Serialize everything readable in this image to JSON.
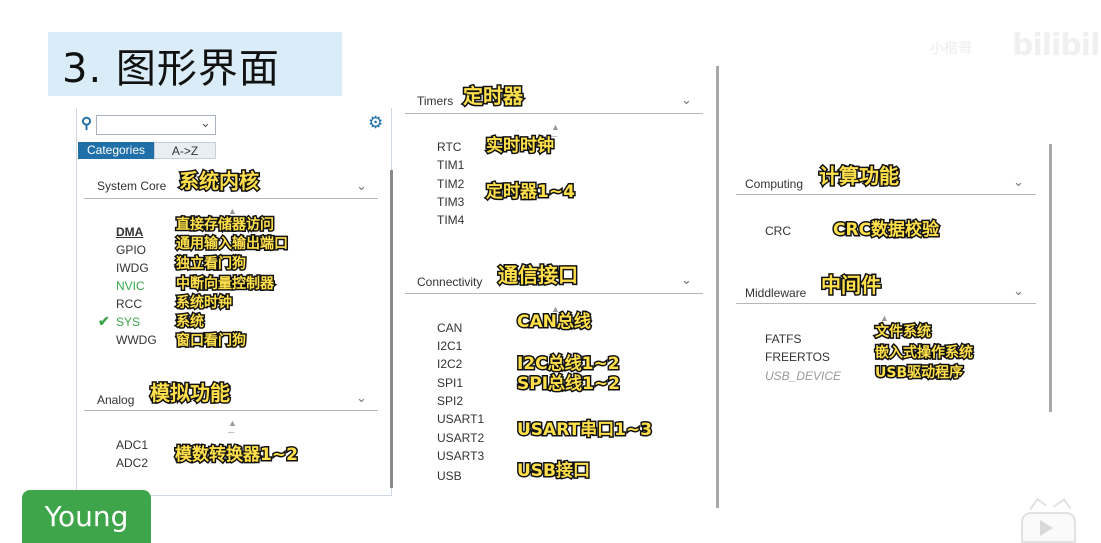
{
  "slide": {
    "title": "3. 图形界面",
    "watermark": "bilibili",
    "watermark_small": "小楷哥",
    "author_badge": "Young"
  },
  "left_panel": {
    "tabs": [
      "Categories",
      "A->Z"
    ],
    "sections": {
      "system_core": {
        "label": "System Core",
        "annotation": "系统内核",
        "items": [
          {
            "name": "DMA",
            "note": "直接存储器访问"
          },
          {
            "name": "GPIO",
            "note": "通用输入输出端口"
          },
          {
            "name": "IWDG",
            "note": "独立看门狗"
          },
          {
            "name": "NVIC",
            "note": "中断向量控制器"
          },
          {
            "name": "RCC",
            "note": "系统时钟"
          },
          {
            "name": "SYS",
            "note": "系统"
          },
          {
            "name": "WWDG",
            "note": "窗口看门狗"
          }
        ]
      },
      "analog": {
        "label": "Analog",
        "annotation": "模拟功能",
        "items": [
          "ADC1",
          "ADC2"
        ],
        "note": "模数转换器1~2"
      }
    }
  },
  "middle_panel": {
    "timers": {
      "label": "Timers",
      "annotation": "定时器",
      "items": [
        "RTC",
        "TIM1",
        "TIM2",
        "TIM3",
        "TIM4"
      ],
      "notes": {
        "rtc": "实时时钟",
        "tim": "定时器1~4"
      }
    },
    "connectivity": {
      "label": "Connectivity",
      "annotation": "通信接口",
      "items": [
        "CAN",
        "I2C1",
        "I2C2",
        "SPI1",
        "SPI2",
        "USART1",
        "USART2",
        "USART3",
        "USB"
      ],
      "notes": {
        "can": "CAN总线",
        "i2c": "I2C总线1~2",
        "spi": "SPI总线1~2",
        "usart": "USART串口1~3",
        "usb": "USB接口"
      }
    }
  },
  "right_panel": {
    "computing": {
      "label": "Computing",
      "annotation": "计算功能",
      "items": [
        "CRC"
      ],
      "note": "CRC数据校验"
    },
    "middleware": {
      "label": "Middleware",
      "annotation": "中间件",
      "items": [
        "FATFS",
        "FREERTOS",
        "USB_DEVICE"
      ],
      "notes": [
        "文件系统",
        "嵌入式操作系统",
        "USB驱动程序"
      ]
    }
  },
  "colors": {
    "accent": "#1f6fa8",
    "title_bg": "#d9ecf7",
    "badge": "#3fa54a",
    "tag_fill": "#ffe04a",
    "green_item": "#3aa64b"
  }
}
